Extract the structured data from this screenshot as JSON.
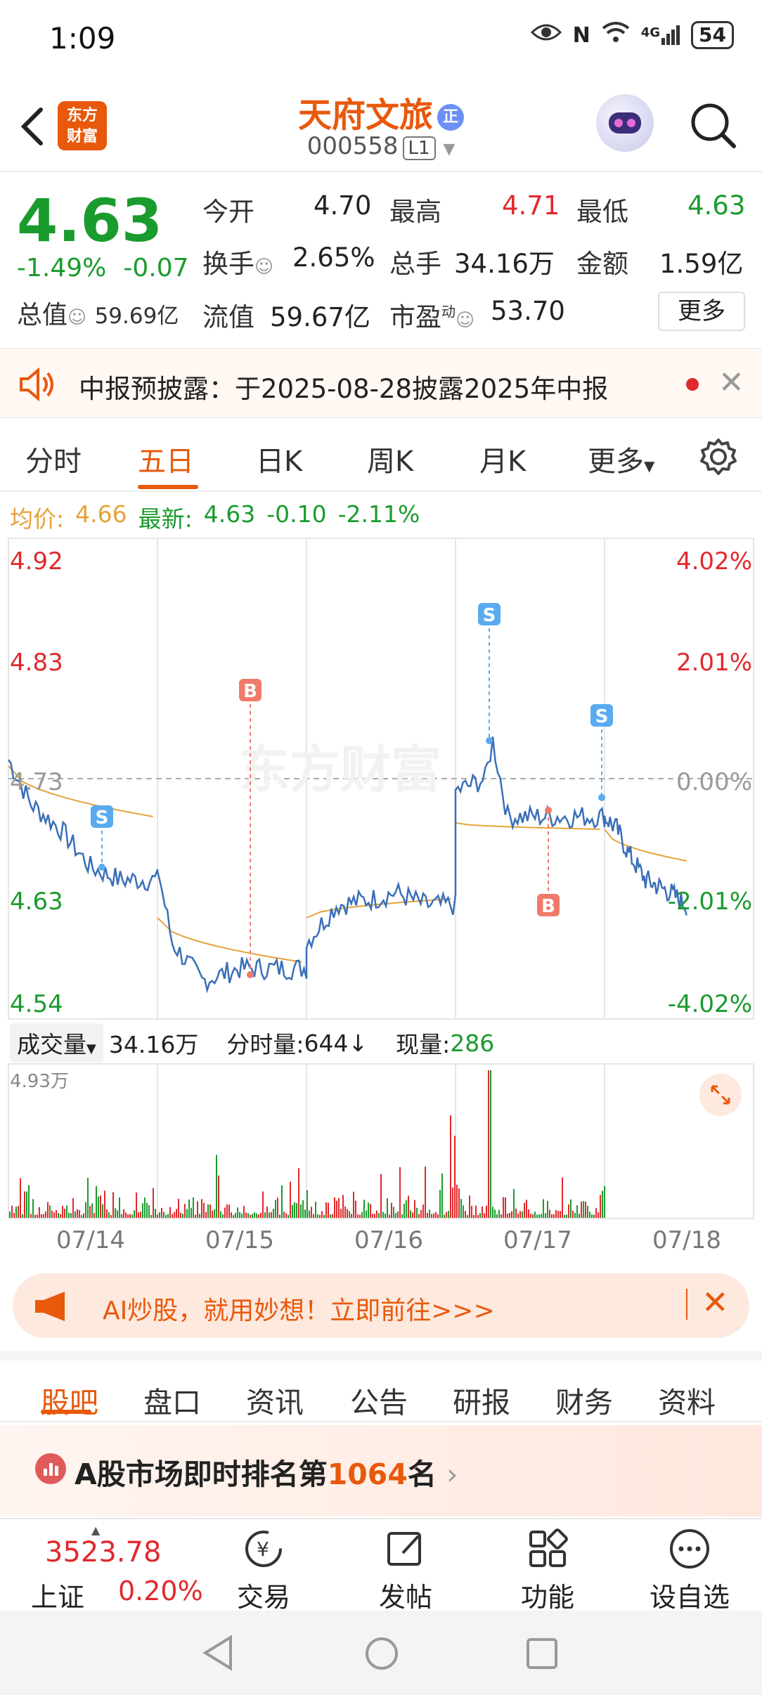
{
  "status_bar": {
    "time": "1:09",
    "network": "4G",
    "battery": "54"
  },
  "header": {
    "logo_line1": "东方",
    "logo_line2": "财富",
    "stock_name": "天府文旅",
    "reg_badge": "正",
    "stock_code": "000558",
    "level": "L1"
  },
  "quote": {
    "price": "4.63",
    "change_pct": "-1.49%",
    "change_abs": "-0.07",
    "total_value_label": "总值",
    "total_value": "59.69亿",
    "open_label": "今开",
    "open": "4.70",
    "high_label": "最高",
    "high": "4.71",
    "low_label": "最低",
    "low": "4.63",
    "turnover_label": "换手",
    "turnover": "2.65%",
    "volume_label": "总手",
    "volume": "34.16万",
    "amount_label": "金额",
    "amount": "1.59亿",
    "float_value_label": "流值",
    "float_value": "59.67亿",
    "pe_label": "市盈",
    "pe_sup": "动",
    "pe": "53.70",
    "more_label": "更多"
  },
  "notice": {
    "text": "中报预披露：于2025-08-28披露2025年中报"
  },
  "chart_tabs": [
    "分时",
    "五日",
    "日K",
    "周K",
    "月K",
    "更多"
  ],
  "chart_tabs_active": 1,
  "avg_line": {
    "avg_label": "均价:",
    "avg": "4.66",
    "latest_label": "最新:",
    "latest": "4.63",
    "change": "-0.10",
    "change_pct": "-2.11%"
  },
  "chart_data": {
    "type": "line",
    "y_labels_left": [
      "4.92",
      "4.83",
      "4.73",
      "4.63",
      "4.54"
    ],
    "y_labels_right": [
      "4.02%",
      "2.01%",
      "0.00%",
      "-2.01%",
      "-4.02%"
    ],
    "ylim": [
      4.54,
      4.92
    ],
    "x_categories": [
      "07/14",
      "07/15",
      "07/16",
      "07/17",
      "07/18"
    ],
    "series": [],
    "markers": [
      {
        "label": "S",
        "day": "07/14"
      },
      {
        "label": "B",
        "day": "07/15"
      },
      {
        "label": "S",
        "day": "07/17"
      },
      {
        "label": "B",
        "day": "07/17"
      },
      {
        "label": "S",
        "day": "07/17"
      }
    ],
    "colors": {
      "price": "#3a6fb8",
      "avg": "#e5a33a",
      "vol_up": "#e0292d",
      "vol_down": "#1a9b2e"
    }
  },
  "volume_header": {
    "label": "成交量",
    "total": "34.16万",
    "tick_label": "分时量:",
    "tick_value": "644",
    "tick_arrow": "↓",
    "current_label": "现量:",
    "current_value": "286",
    "max": "4.93万"
  },
  "ad_banner": {
    "text": "AI炒股，就用妙想！立即前往>>>"
  },
  "section_tabs": [
    "股吧",
    "盘口",
    "资讯",
    "公告",
    "研报",
    "财务",
    "资料"
  ],
  "section_tabs_active": 0,
  "rank": {
    "prefix": "A股市场即时排名第",
    "number": "1064",
    "suffix": "名"
  },
  "bottom_bar": {
    "index_value": "3523.78",
    "index_name": "上证",
    "index_pct": "0.20%",
    "nav": [
      "交易",
      "发帖",
      "功能",
      "设自选"
    ]
  }
}
